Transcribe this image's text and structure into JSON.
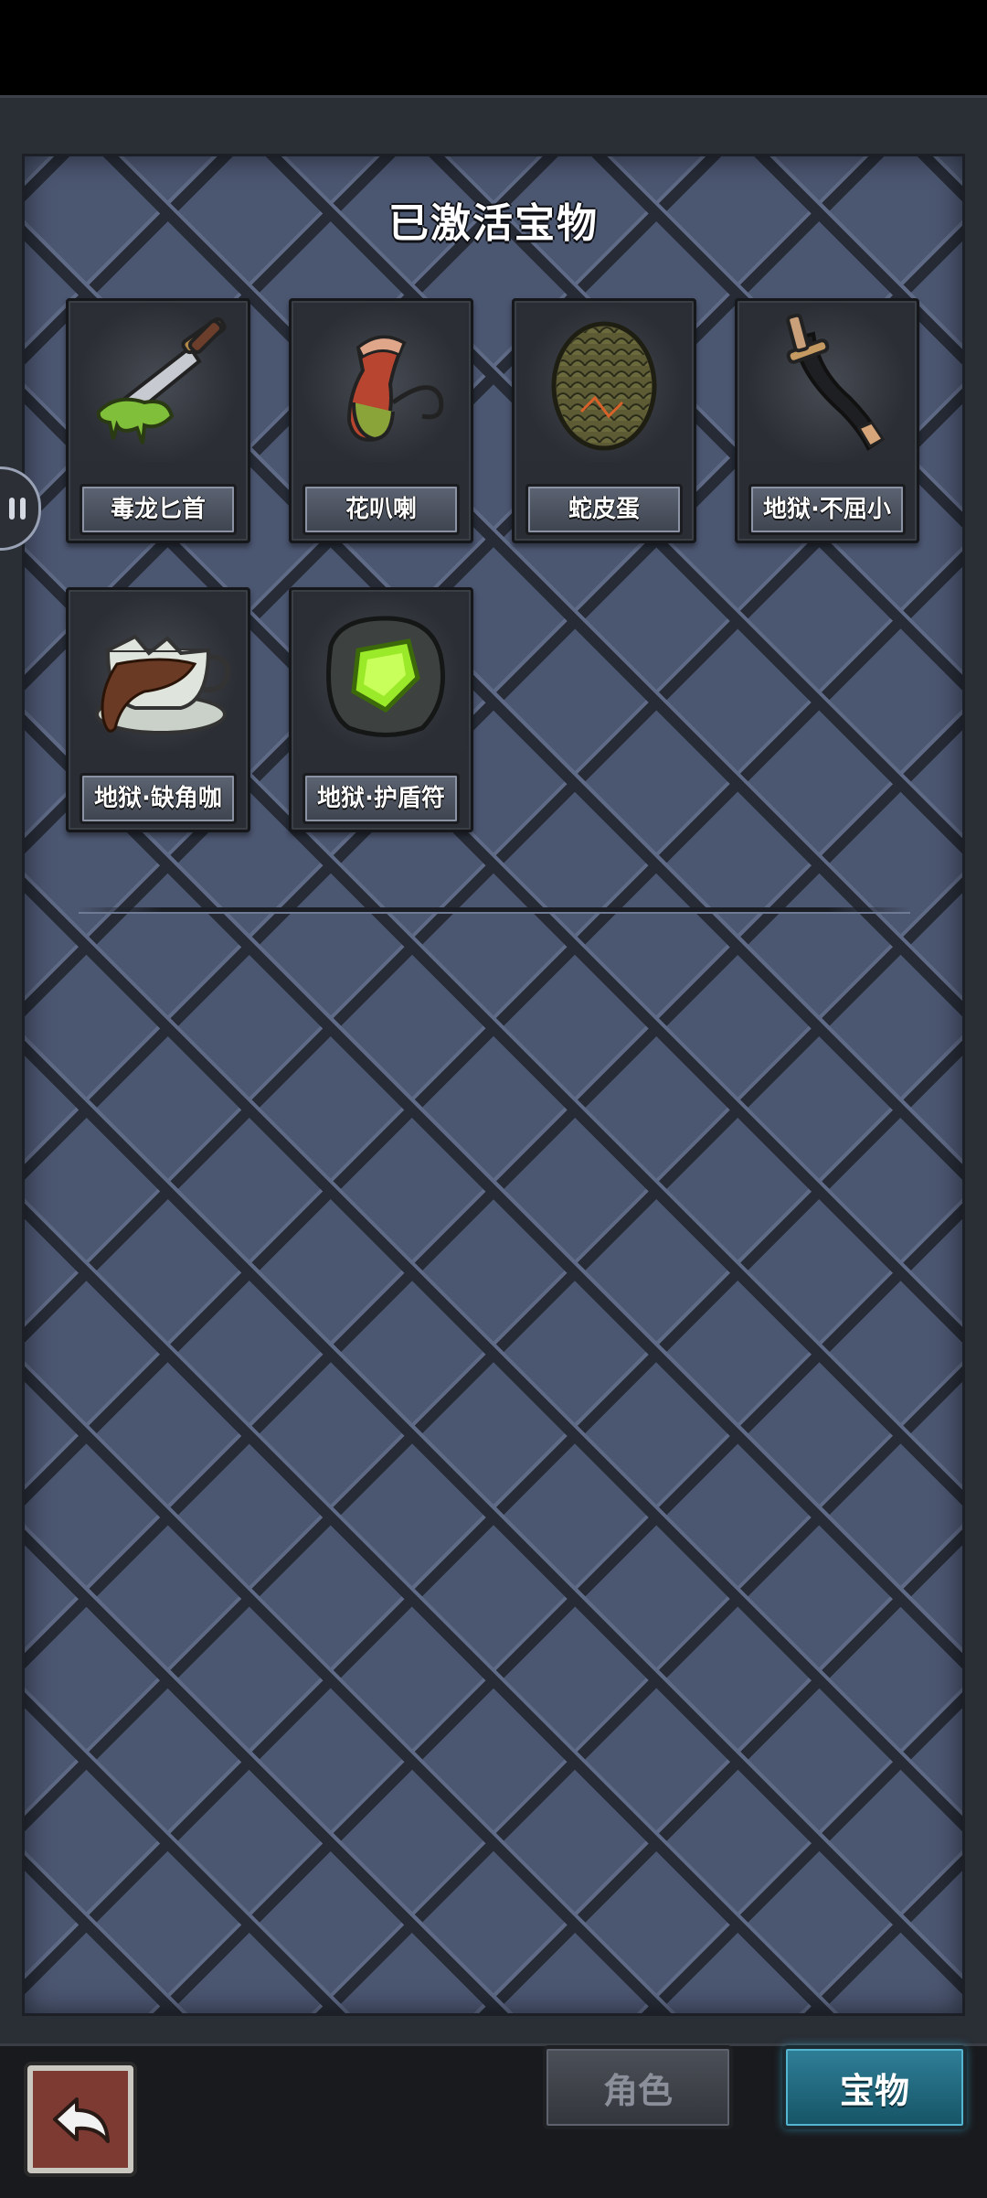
{
  "panel": {
    "title": "已激活宝物"
  },
  "treasures": [
    {
      "name": "毒龙匕首",
      "icon": "poison-dagger-icon"
    },
    {
      "name": "花叭喇",
      "icon": "pitcher-plant-icon"
    },
    {
      "name": "蛇皮蛋",
      "icon": "snake-skin-egg-icon"
    },
    {
      "name": "地狱·不屈小",
      "icon": "curved-blade-icon"
    },
    {
      "name": "地狱·缺角咖",
      "icon": "broken-coffee-cup-icon"
    },
    {
      "name": "地狱·护盾符",
      "icon": "green-crystal-rock-icon"
    }
  ],
  "bottom_nav": {
    "tabs": [
      {
        "label": "角色",
        "active": false
      },
      {
        "label": "宝物",
        "active": true
      }
    ],
    "back_icon": "return-arrow-icon"
  },
  "colors": {
    "panel_bg": "#4b5670",
    "active_tab": "#2f7f98",
    "back_button": "#7c3a32"
  }
}
